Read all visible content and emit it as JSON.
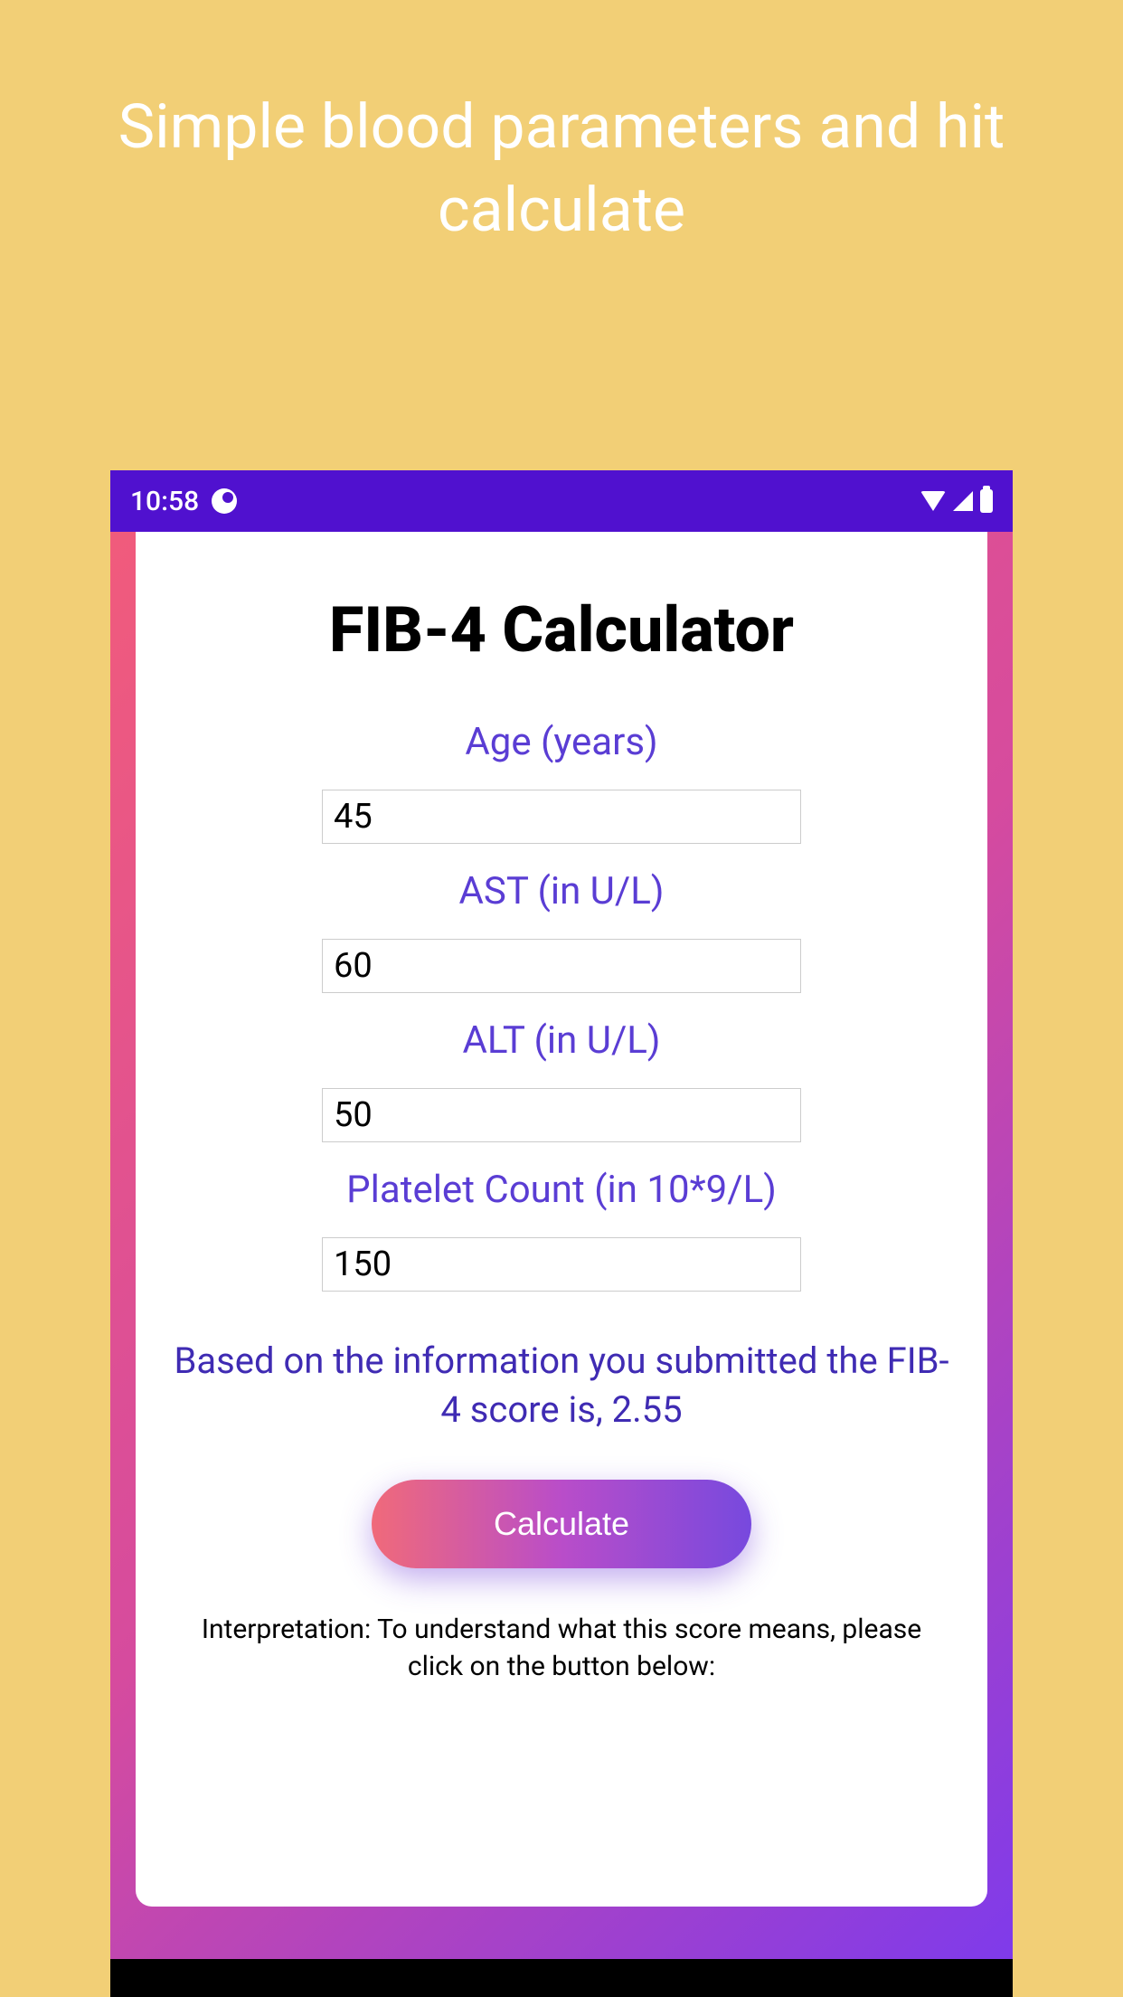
{
  "promo": {
    "headline": "Simple blood parameters and hit calculate"
  },
  "statusBar": {
    "time": "10:58"
  },
  "app": {
    "title": "FIB-4 Calculator",
    "fields": {
      "age": {
        "label": "Age (years)",
        "value": "45"
      },
      "ast": {
        "label": "AST (in U/L)",
        "value": "60"
      },
      "alt": {
        "label": "ALT (in U/L)",
        "value": "50"
      },
      "platelet": {
        "label": "Platelet Count (in 10*9/L)",
        "value": "150"
      }
    },
    "result": "Based on the information you submitted the FIB-4 score is, 2.55",
    "calculateLabel": "Calculate",
    "interpretation": "Interpretation: To understand what this score means, please click on the button below:"
  }
}
